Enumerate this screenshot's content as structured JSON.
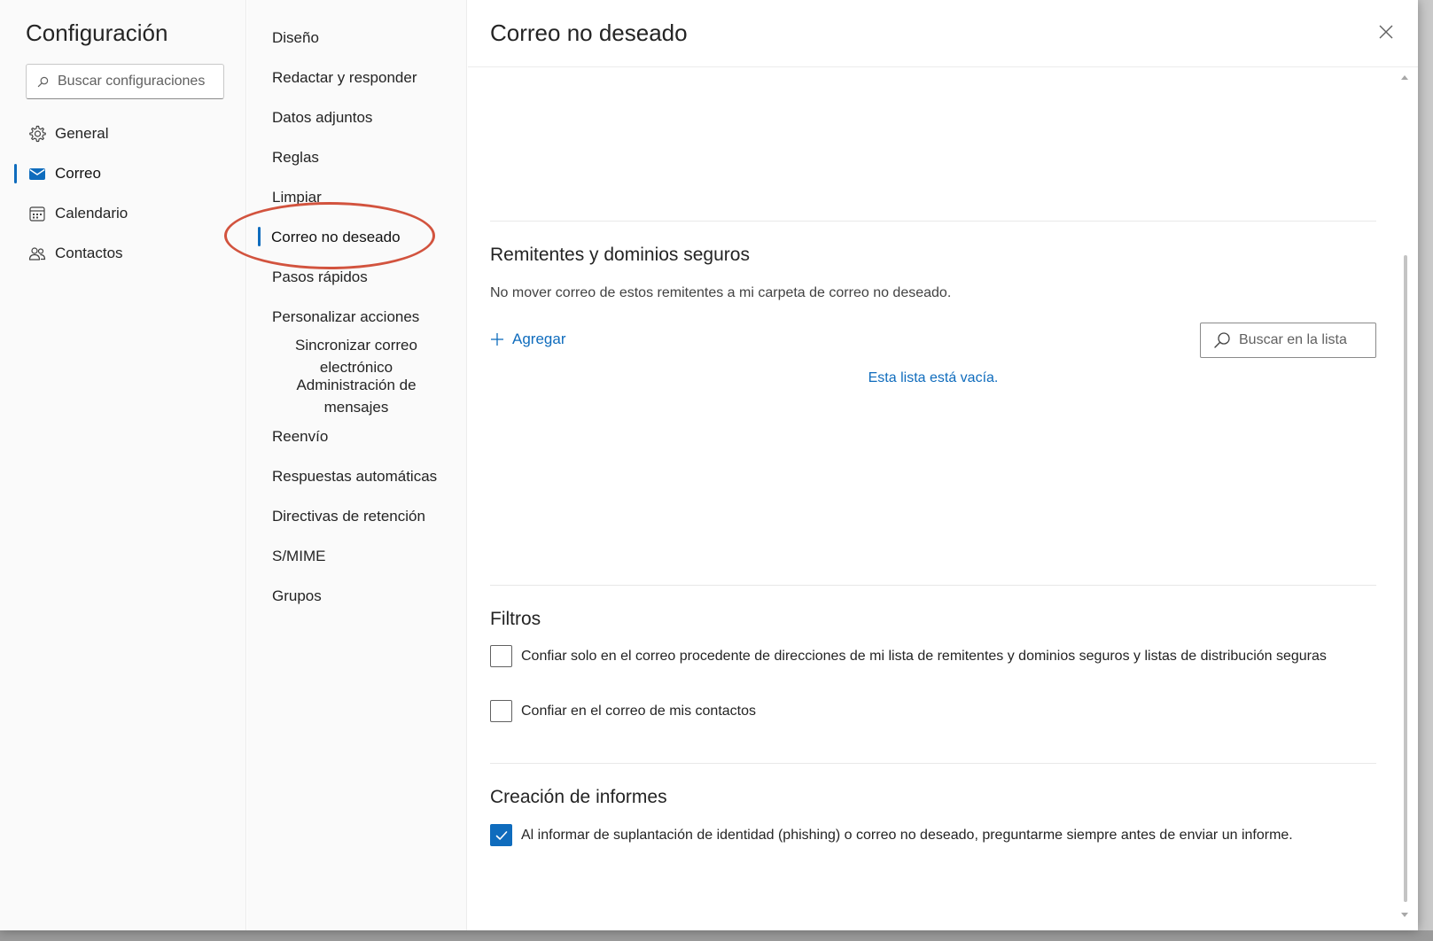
{
  "settings": {
    "title": "Configuración",
    "search_placeholder": "Buscar configuraciones"
  },
  "nav1": {
    "items": [
      {
        "label": "General",
        "icon": "gear-icon"
      },
      {
        "label": "Correo",
        "icon": "mail-icon",
        "selected": true
      },
      {
        "label": "Calendario",
        "icon": "calendar-icon"
      },
      {
        "label": "Contactos",
        "icon": "people-icon"
      }
    ]
  },
  "nav2": {
    "items": [
      {
        "label": "Diseño"
      },
      {
        "label": "Redactar y responder"
      },
      {
        "label": "Datos adjuntos"
      },
      {
        "label": "Reglas"
      },
      {
        "label": "Limpiar"
      },
      {
        "label": "Correo no deseado",
        "selected": true
      },
      {
        "label": "Pasos rápidos"
      },
      {
        "label": "Personalizar acciones"
      },
      {
        "label": "Sincronizar correo electrónico"
      },
      {
        "label": "Administración de mensajes"
      },
      {
        "label": "Reenvío"
      },
      {
        "label": "Respuestas automáticas"
      },
      {
        "label": "Directivas de retención"
      },
      {
        "label": "S/MIME"
      },
      {
        "label": "Grupos"
      }
    ]
  },
  "main": {
    "title": "Correo no deseado",
    "safe_senders": {
      "title": "Remitentes y dominios seguros",
      "description": "No mover correo de estos remitentes a mi carpeta de correo no deseado.",
      "add_label": "Agregar",
      "search_label": "Buscar en la lista",
      "empty_message": "Esta lista está vacía."
    },
    "filters": {
      "title": "Filtros",
      "options": [
        {
          "label": "Confiar solo en el correo procedente de direcciones de mi lista de remitentes y dominios seguros y listas de distribución seguras",
          "checked": false
        },
        {
          "label": "Confiar en el correo de mis contactos",
          "checked": false
        }
      ]
    },
    "reporting": {
      "title": "Creación de informes",
      "options": [
        {
          "label": "Al informar de suplantación de identidad (phishing) o correo no deseado, preguntarme siempre antes de enviar un informe.",
          "checked": true
        }
      ]
    }
  },
  "colors": {
    "accent": "#0f6cbd",
    "highlight": "#d2533e"
  }
}
